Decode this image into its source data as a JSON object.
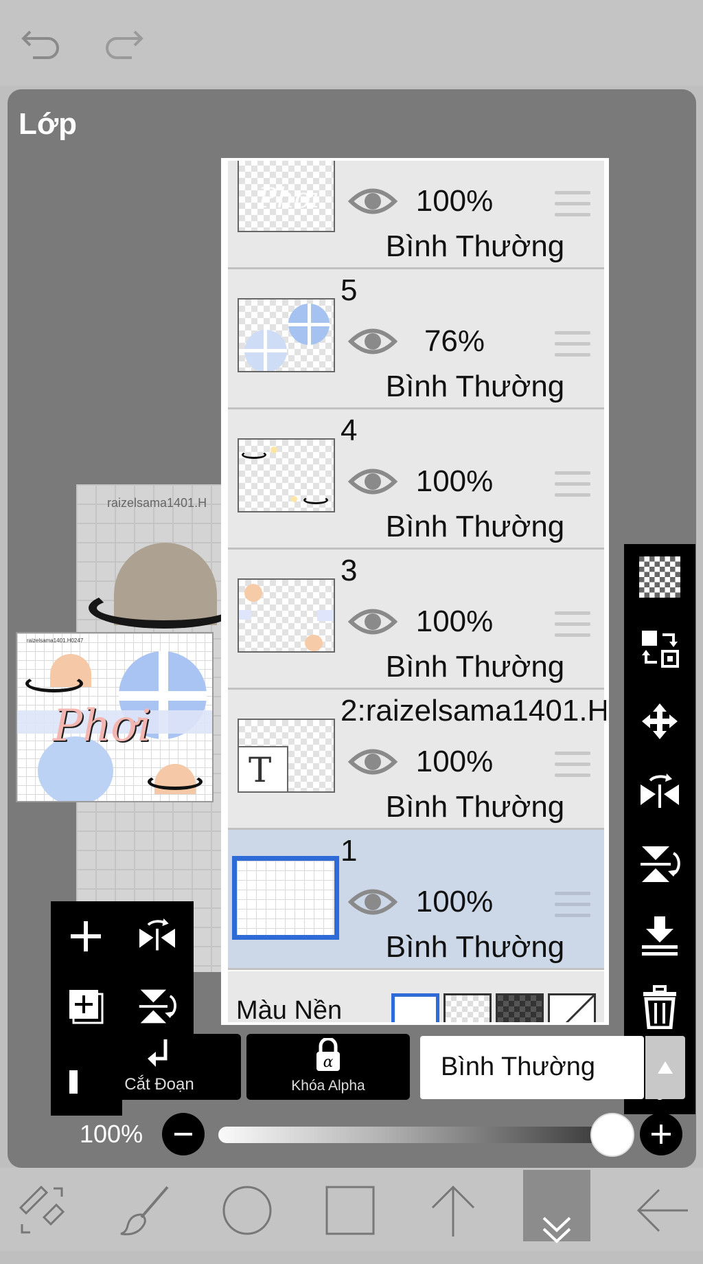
{
  "panel": {
    "title": "Lớp"
  },
  "canvas": {
    "watermark": "raizelsama1401.H",
    "thumb_watermark": "raizelsama1401.H0247",
    "thumb_text": "Phơi"
  },
  "layers": [
    {
      "number": "",
      "opacity": "100%",
      "blend": "Bình Thường",
      "thumb": "phoi-text",
      "selected": false
    },
    {
      "number": "5",
      "opacity": "76%",
      "blend": "Bình Thường",
      "thumb": "circles",
      "selected": false
    },
    {
      "number": "4",
      "opacity": "100%",
      "blend": "Bình Thường",
      "thumb": "planets",
      "selected": false
    },
    {
      "number": "3",
      "opacity": "100%",
      "blend": "Bình Thường",
      "thumb": "dots",
      "selected": false
    },
    {
      "number": "2:raizelsama1401.H",
      "opacity": "100%",
      "blend": "Bình Thường",
      "thumb": "text",
      "thumb_letter": "T",
      "selected": false
    },
    {
      "number": "1",
      "opacity": "100%",
      "blend": "Bình Thường",
      "thumb": "grid",
      "selected": true
    }
  ],
  "background": {
    "label": "Màu Nền",
    "swatches": [
      "white",
      "light-checker",
      "dark-checker",
      "none"
    ]
  },
  "right_toolbar": [
    "checker-icon",
    "swap-layers-icon",
    "move-icon",
    "flip-horizontal-icon",
    "flip-vertical-icon",
    "merge-down-icon",
    "trash-icon",
    "more-icon"
  ],
  "left_toolbar": [
    "add-layer-icon",
    "flip-h-icon",
    "duplicate-layer-icon",
    "flip-v-icon",
    "camera-icon"
  ],
  "controls": {
    "clip_label": "Cắt Đoạn",
    "alpha_label": "Khóa Alpha",
    "blend_mode": "Bình Thường",
    "opacity_value": "100%",
    "opacity_fraction": 1.0
  },
  "bottom_toolbar": [
    "transform-icon",
    "brush-icon",
    "circle-icon",
    "square-icon",
    "arrow-up-icon",
    "collapse-icon",
    "back-icon"
  ]
}
